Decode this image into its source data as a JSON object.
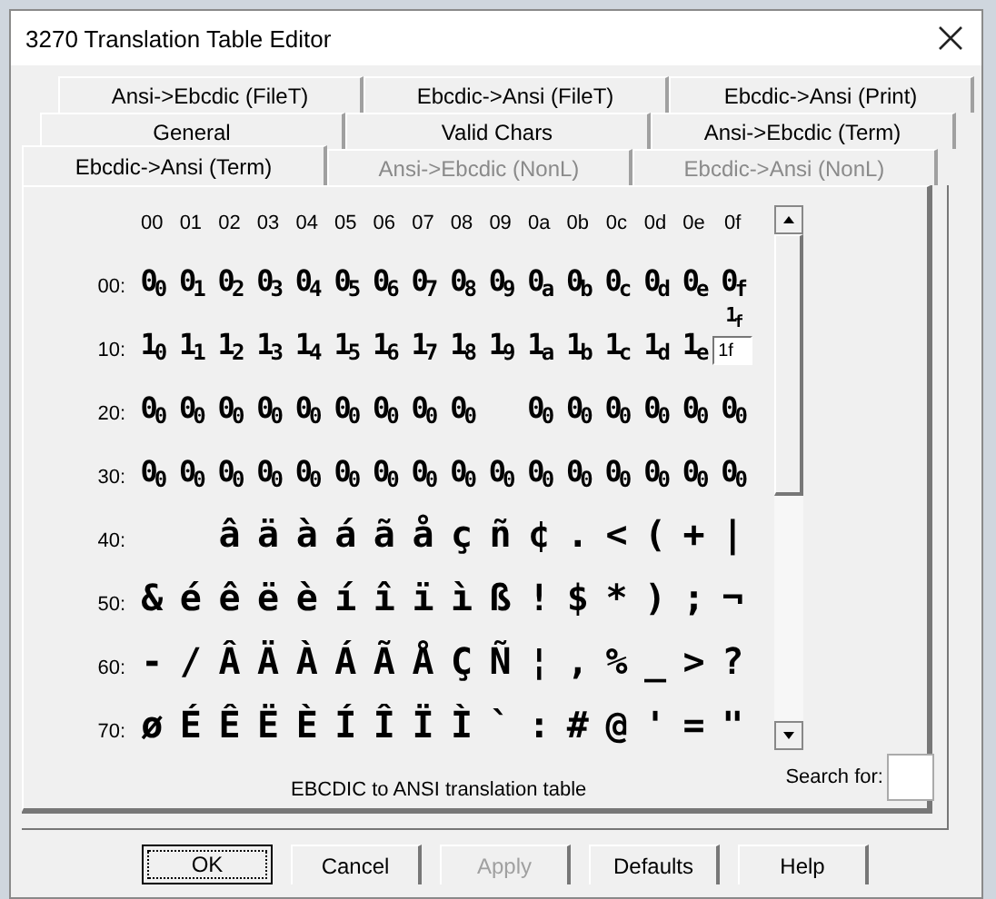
{
  "window": {
    "title": "3270 Translation Table Editor"
  },
  "tab_rows": [
    [
      {
        "label": "Ansi->Ebcdic (FileT)",
        "selected": false,
        "disabled": false
      },
      {
        "label": "Ebcdic->Ansi (FileT)",
        "selected": false,
        "disabled": false
      },
      {
        "label": "Ebcdic->Ansi (Print)",
        "selected": false,
        "disabled": false
      }
    ],
    [
      {
        "label": "General",
        "selected": false,
        "disabled": false
      },
      {
        "label": "Valid Chars",
        "selected": false,
        "disabled": false
      },
      {
        "label": "Ansi->Ebcdic (Term)",
        "selected": false,
        "disabled": false
      }
    ],
    [
      {
        "label": "Ebcdic->Ansi (Term)",
        "selected": true,
        "disabled": false
      },
      {
        "label": "Ansi->Ebcdic (NonL)",
        "selected": false,
        "disabled": true
      },
      {
        "label": "Ebcdic->Ansi (NonL)",
        "selected": false,
        "disabled": true
      }
    ]
  ],
  "table": {
    "columns": [
      "00",
      "01",
      "02",
      "03",
      "04",
      "05",
      "06",
      "07",
      "08",
      "09",
      "0a",
      "0b",
      "0c",
      "0d",
      "0e",
      "0f"
    ],
    "rows": [
      {
        "label": "00:",
        "cells": [
          {
            "kind": "hex",
            "text": "0$_{0}$"
          },
          {
            "kind": "hex",
            "text": "0$_{1}$"
          },
          {
            "kind": "hex",
            "text": "0$_{2}$"
          },
          {
            "kind": "hex",
            "text": "0$_{3}$"
          },
          {
            "kind": "hex",
            "text": "0$_{4}$"
          },
          {
            "kind": "hex",
            "text": "0$_{5}$"
          },
          {
            "kind": "hex",
            "text": "0$_{6}$"
          },
          {
            "kind": "hex",
            "text": "0$_{7}$"
          },
          {
            "kind": "hex",
            "text": "0$_{8}$"
          },
          {
            "kind": "hex",
            "text": "0$_{9}$"
          },
          {
            "kind": "hex",
            "text": "0$_{a}$"
          },
          {
            "kind": "hex",
            "text": "0$_{b}$"
          },
          {
            "kind": "hex",
            "text": "0$_{c}$"
          },
          {
            "kind": "hex",
            "text": "0$_{d}$"
          },
          {
            "kind": "hex",
            "text": "0$_{e}$"
          },
          {
            "kind": "hex",
            "text": "0$_{f}$"
          }
        ]
      },
      {
        "label": "10:",
        "cells": [
          {
            "kind": "hex",
            "text": "1$_{0}$"
          },
          {
            "kind": "hex",
            "text": "1$_{1}$"
          },
          {
            "kind": "hex",
            "text": "1$_{2}$"
          },
          {
            "kind": "hex",
            "text": "1$_{3}$"
          },
          {
            "kind": "hex",
            "text": "1$_{4}$"
          },
          {
            "kind": "hex",
            "text": "1$_{5}$"
          },
          {
            "kind": "hex",
            "text": "1$_{6}$"
          },
          {
            "kind": "hex",
            "text": "1$_{7}$"
          },
          {
            "kind": "hex",
            "text": "1$_{8}$"
          },
          {
            "kind": "hex",
            "text": "1$_{9}$"
          },
          {
            "kind": "hex",
            "text": "1$_{a}$"
          },
          {
            "kind": "hex",
            "text": "1$_{b}$"
          },
          {
            "kind": "hex",
            "text": "1$_{c}$"
          },
          {
            "kind": "hex",
            "text": "1$_{d}$"
          },
          {
            "kind": "hex",
            "text": "1$_{e}$"
          },
          {
            "kind": "edit",
            "text": "1$_{f}$",
            "value": "1f"
          }
        ]
      },
      {
        "label": "20:",
        "cells": [
          {
            "kind": "hex",
            "text": "0$_{0}$"
          },
          {
            "kind": "hex",
            "text": "0$_{0}$"
          },
          {
            "kind": "hex",
            "text": "0$_{0}$"
          },
          {
            "kind": "hex",
            "text": "0$_{0}$"
          },
          {
            "kind": "hex",
            "text": "0$_{0}$"
          },
          {
            "kind": "hex",
            "text": "0$_{0}$"
          },
          {
            "kind": "hex",
            "text": "0$_{0}$"
          },
          {
            "kind": "hex",
            "text": "0$_{0}$"
          },
          {
            "kind": "hex",
            "text": "0$_{0}$"
          },
          {
            "kind": "blank"
          },
          {
            "kind": "hex",
            "text": "0$_{0}$"
          },
          {
            "kind": "hex",
            "text": "0$_{0}$"
          },
          {
            "kind": "hex",
            "text": "0$_{0}$"
          },
          {
            "kind": "hex",
            "text": "0$_{0}$"
          },
          {
            "kind": "hex",
            "text": "0$_{0}$"
          },
          {
            "kind": "hex",
            "text": "0$_{0}$"
          }
        ]
      },
      {
        "label": "30:",
        "cells": [
          {
            "kind": "hex",
            "text": "0$_{0}$"
          },
          {
            "kind": "hex",
            "text": "0$_{0}$"
          },
          {
            "kind": "hex",
            "text": "0$_{0}$"
          },
          {
            "kind": "hex",
            "text": "0$_{0}$"
          },
          {
            "kind": "hex",
            "text": "0$_{0}$"
          },
          {
            "kind": "hex",
            "text": "0$_{0}$"
          },
          {
            "kind": "hex",
            "text": "0$_{0}$"
          },
          {
            "kind": "hex",
            "text": "0$_{0}$"
          },
          {
            "kind": "hex",
            "text": "0$_{0}$"
          },
          {
            "kind": "hex",
            "text": "0$_{0}$"
          },
          {
            "kind": "hex",
            "text": "0$_{0}$"
          },
          {
            "kind": "hex",
            "text": "0$_{0}$"
          },
          {
            "kind": "hex",
            "text": "0$_{0}$"
          },
          {
            "kind": "hex",
            "text": "0$_{0}$"
          },
          {
            "kind": "hex",
            "text": "0$_{0}$"
          },
          {
            "kind": "hex",
            "text": "0$_{0}$"
          }
        ]
      },
      {
        "label": "40:",
        "cells": [
          {
            "kind": "blank"
          },
          {
            "kind": "blank"
          },
          {
            "kind": "char",
            "text": "â"
          },
          {
            "kind": "char",
            "text": "ä"
          },
          {
            "kind": "char",
            "text": "à"
          },
          {
            "kind": "char",
            "text": "á"
          },
          {
            "kind": "char",
            "text": "ã"
          },
          {
            "kind": "char",
            "text": "å"
          },
          {
            "kind": "char",
            "text": "ç"
          },
          {
            "kind": "char",
            "text": "ñ"
          },
          {
            "kind": "char",
            "text": "¢"
          },
          {
            "kind": "char",
            "text": "."
          },
          {
            "kind": "char",
            "text": "<"
          },
          {
            "kind": "char",
            "text": "("
          },
          {
            "kind": "char",
            "text": "+"
          },
          {
            "kind": "char",
            "text": "|"
          }
        ]
      },
      {
        "label": "50:",
        "cells": [
          {
            "kind": "char",
            "text": "&"
          },
          {
            "kind": "char",
            "text": "é"
          },
          {
            "kind": "char",
            "text": "ê"
          },
          {
            "kind": "char",
            "text": "ë"
          },
          {
            "kind": "char",
            "text": "è"
          },
          {
            "kind": "char",
            "text": "í"
          },
          {
            "kind": "char",
            "text": "î"
          },
          {
            "kind": "char",
            "text": "ï"
          },
          {
            "kind": "char",
            "text": "ì"
          },
          {
            "kind": "char",
            "text": "ß"
          },
          {
            "kind": "char",
            "text": "!"
          },
          {
            "kind": "char",
            "text": "$"
          },
          {
            "kind": "char",
            "text": "*"
          },
          {
            "kind": "char",
            "text": ")"
          },
          {
            "kind": "char",
            "text": ";"
          },
          {
            "kind": "char",
            "text": "¬"
          }
        ]
      },
      {
        "label": "60:",
        "cells": [
          {
            "kind": "char",
            "text": "-"
          },
          {
            "kind": "char",
            "text": "/"
          },
          {
            "kind": "char",
            "text": "Â"
          },
          {
            "kind": "char",
            "text": "Ä"
          },
          {
            "kind": "char",
            "text": "À"
          },
          {
            "kind": "char",
            "text": "Á"
          },
          {
            "kind": "char",
            "text": "Ã"
          },
          {
            "kind": "char",
            "text": "Å"
          },
          {
            "kind": "char",
            "text": "Ç"
          },
          {
            "kind": "char",
            "text": "Ñ"
          },
          {
            "kind": "char",
            "text": "¦"
          },
          {
            "kind": "char",
            "text": ","
          },
          {
            "kind": "char",
            "text": "%"
          },
          {
            "kind": "char",
            "text": "_"
          },
          {
            "kind": "char",
            "text": ">"
          },
          {
            "kind": "char",
            "text": "?"
          }
        ]
      },
      {
        "label": "70:",
        "cells": [
          {
            "kind": "char",
            "text": "ø"
          },
          {
            "kind": "char",
            "text": "É"
          },
          {
            "kind": "char",
            "text": "Ê"
          },
          {
            "kind": "char",
            "text": "Ë"
          },
          {
            "kind": "char",
            "text": "È"
          },
          {
            "kind": "char",
            "text": "Í"
          },
          {
            "kind": "char",
            "text": "Î"
          },
          {
            "kind": "char",
            "text": "Ï"
          },
          {
            "kind": "char",
            "text": "Ì"
          },
          {
            "kind": "char",
            "text": "`"
          },
          {
            "kind": "char",
            "text": ":"
          },
          {
            "kind": "char",
            "text": "#"
          },
          {
            "kind": "char",
            "text": "@"
          },
          {
            "kind": "char",
            "text": "'"
          },
          {
            "kind": "char",
            "text": "="
          },
          {
            "kind": "char",
            "text": "\""
          }
        ]
      }
    ]
  },
  "caption": "EBCDIC to ANSI translation table",
  "search": {
    "label": "Search for:"
  },
  "buttons": [
    {
      "label": "OK",
      "disabled": false,
      "default": true
    },
    {
      "label": "Cancel",
      "disabled": false,
      "default": false
    },
    {
      "label": "Apply",
      "disabled": true,
      "default": false
    },
    {
      "label": "Defaults",
      "disabled": false,
      "default": false
    },
    {
      "label": "Help",
      "disabled": false,
      "default": false
    }
  ]
}
